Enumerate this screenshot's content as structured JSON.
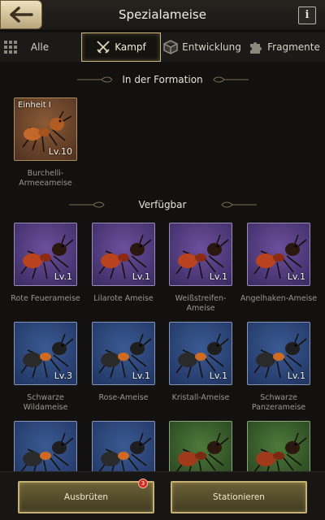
{
  "header": {
    "title": "Spezialameise",
    "info_label": "i"
  },
  "tabs": [
    {
      "label": "Alle",
      "icon": "grid-icon",
      "active": false
    },
    {
      "label": "Kampf",
      "icon": "crossed-swords-icon",
      "active": true
    },
    {
      "label": "Entwicklung",
      "icon": "cube-icon",
      "active": false
    },
    {
      "label": "Fragmente",
      "icon": "puzzle-icon",
      "active": false
    }
  ],
  "formation": {
    "title": "In der Formation",
    "cards": [
      {
        "unit": "Einheit I",
        "level": "Lv.10",
        "name": "Burchelli-Armeeameise",
        "rarity": "brown"
      }
    ]
  },
  "available": {
    "title": "Verfügbar",
    "cards": [
      {
        "level": "Lv.1",
        "name": "Rote Feuerameise",
        "rarity": "purple"
      },
      {
        "level": "Lv.1",
        "name": "Lilarote Ameise",
        "rarity": "purple"
      },
      {
        "level": "Lv.1",
        "name": "Weißstreifen-Ameise",
        "rarity": "purple"
      },
      {
        "level": "Lv.1",
        "name": "Angelhaken-Ameise",
        "rarity": "purple"
      },
      {
        "level": "Lv.3",
        "name": "Schwarze Wildameise",
        "rarity": "blue"
      },
      {
        "level": "Lv.1",
        "name": "Rose-Ameise",
        "rarity": "blue"
      },
      {
        "level": "Lv.1",
        "name": "Kristall-Ameise",
        "rarity": "blue"
      },
      {
        "level": "Lv.1",
        "name": "Schwarze Panzerameise",
        "rarity": "blue"
      },
      {
        "level": "",
        "name": "",
        "rarity": "blue"
      },
      {
        "level": "",
        "name": "",
        "rarity": "blue"
      },
      {
        "level": "",
        "name": "",
        "rarity": "green"
      },
      {
        "level": "",
        "name": "",
        "rarity": "green"
      }
    ]
  },
  "footer": {
    "hatch_label": "Ausbrüten",
    "hatch_badge": "3",
    "station_label": "Stationieren"
  }
}
